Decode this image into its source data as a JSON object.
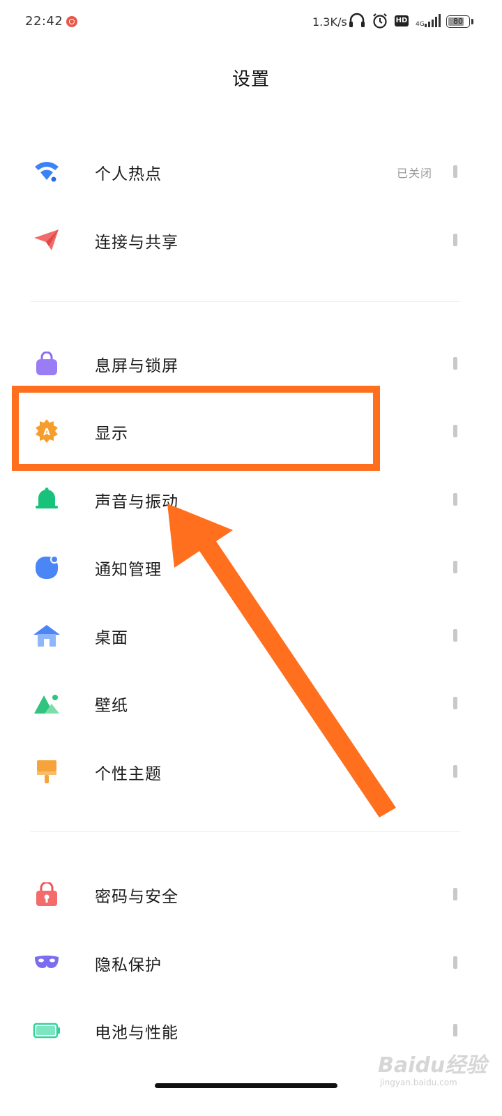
{
  "status_bar": {
    "time": "22:42",
    "net_speed": "1.3K/s",
    "hd_badge": "HD",
    "signal_label": "4G",
    "battery": "80",
    "battery_level": 0.8
  },
  "page_title": "设置",
  "sections": [
    {
      "items": [
        {
          "label": "个人热点",
          "value": "已关闭",
          "icon": "hotspot-icon",
          "color": "#3b82f6"
        },
        {
          "label": "连接与共享",
          "icon": "paper-plane-icon",
          "color": "#ef4444"
        }
      ]
    },
    {
      "items": [
        {
          "label": "息屏与锁屏",
          "icon": "lock-bag-icon",
          "color": "#8b6cf0"
        },
        {
          "label": "显示",
          "icon": "display-brightness-icon",
          "color": "#f59e2e"
        },
        {
          "label": "声音与振动",
          "icon": "bell-icon",
          "color": "#19c27a"
        },
        {
          "label": "通知管理",
          "icon": "notification-icon",
          "color": "#4a86f5"
        },
        {
          "label": "桌面",
          "icon": "home-icon",
          "color": "#4a86f5"
        },
        {
          "label": "壁纸",
          "icon": "mountain-icon",
          "color": "#2fc57e"
        },
        {
          "label": "个性主题",
          "icon": "brush-icon",
          "color": "#f6a33b"
        }
      ]
    },
    {
      "items": [
        {
          "label": "密码与安全",
          "icon": "padlock-icon",
          "color": "#ef5555"
        },
        {
          "label": "隐私保护",
          "icon": "mask-icon",
          "color": "#7b6cf0"
        },
        {
          "label": "电池与性能",
          "icon": "battery-icon",
          "color": "#2fd49c"
        }
      ]
    }
  ],
  "annotation": {
    "highlight_color": "#ff6f1e",
    "highlighted_item": "显示"
  },
  "watermark": {
    "text": "Baidu经验",
    "sub": "jingyan.baidu.com"
  }
}
